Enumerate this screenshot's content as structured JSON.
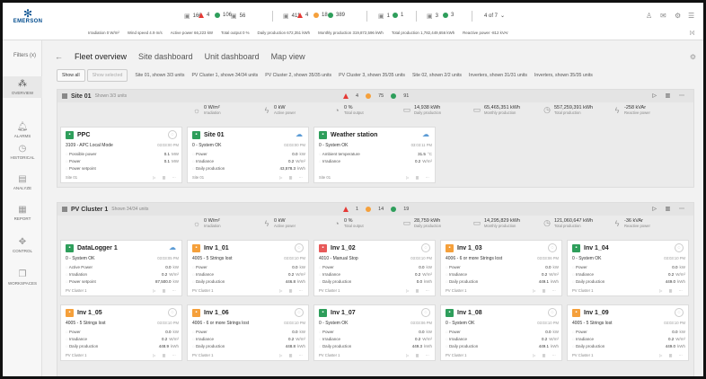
{
  "brand": {
    "logo_text": "EMERSON"
  },
  "topbar": {
    "counts": [
      {
        "icon": "inverter-icon",
        "value": "166",
        "color": "#888888"
      },
      {
        "icon": "alarm-triangle-icon",
        "value": "4",
        "color": "#e53935"
      },
      {
        "icon": "dot-green-icon",
        "value": "106",
        "color": "#2e9e5b"
      },
      {
        "icon": "link-icon",
        "value": "56",
        "color": "#888888"
      },
      {
        "icon": "meter-icon",
        "value": "411",
        "color": "#888888"
      },
      {
        "icon": "alarm-triangle-icon",
        "value": "4",
        "color": "#e53935"
      },
      {
        "icon": "dot-orange-icon",
        "value": "18",
        "color": "#f5a03b"
      },
      {
        "icon": "dot-green-icon",
        "value": "389",
        "color": "#2e9e5b"
      },
      {
        "icon": "device-icon",
        "value": "1",
        "color": "#888888"
      },
      {
        "icon": "dot-green-icon",
        "value": "1",
        "color": "#2e9e5b"
      },
      {
        "icon": "grid-icon",
        "value": "3",
        "color": "#888888"
      },
      {
        "icon": "dot-green-icon",
        "value": "3",
        "color": "#2e9e5b"
      }
    ],
    "pager": "4 of 7",
    "stats": [
      "Irradiation 0 W/m²",
      "Wind speed 4.9 m/s",
      "Active power 66,223 kW",
      "Total output 0 %",
      "Daily production 672,351 kWh",
      "Monthly production 319,872,596 kWh",
      "Total production 1,782,449,656 kWh",
      "Reactive power -812 kVAr"
    ],
    "right_icon": "[x]"
  },
  "sidebar": {
    "filters_label": "Filters",
    "filters_count": "(x)",
    "items": [
      {
        "label": "OVERVIEW",
        "icon": "overview-icon",
        "glyph": "⁂",
        "active": true
      },
      {
        "label": "ALARMS",
        "icon": "alarm-bell-icon",
        "glyph": "🔔︎",
        "active": false
      },
      {
        "label": "HISTORICAL",
        "icon": "history-icon",
        "glyph": "◷",
        "active": false
      },
      {
        "label": "ANALYZE",
        "icon": "analyze-icon",
        "glyph": "▤",
        "active": false
      },
      {
        "label": "REPORT",
        "icon": "report-icon",
        "glyph": "▦",
        "active": false
      },
      {
        "label": "CONTROL",
        "icon": "control-icon",
        "glyph": "✥",
        "active": false
      },
      {
        "label": "WORKSPACES",
        "icon": "workspaces-icon",
        "glyph": "❐",
        "active": false
      }
    ]
  },
  "nav": {
    "back": "←",
    "tabs": [
      "Fleet overview",
      "Site dashboard",
      "Unit dashboard",
      "Map view"
    ]
  },
  "chips": {
    "show_all": "Show all",
    "show_selected": "Show selected",
    "items": [
      "Site 01, shown 3/3 units",
      "PV Cluster 1, shown 34/34 units",
      "PV Cluster 2, shown 35/35 units",
      "PV Cluster 3, shown 35/35 units",
      "Site 02, shown 2/2 units",
      "Inverters, shown 31/31 units",
      "Inverters, shown 35/35 units"
    ]
  },
  "sections": [
    {
      "title": "Site 01",
      "subtitle": "Shown 3/3 units",
      "counts": {
        "alarm": "4",
        "orange": "75",
        "green": "91"
      },
      "kpis": [
        {
          "icon": "irradiation-icon",
          "value": "0 W/m²",
          "label": "Irradiation"
        },
        {
          "icon": "bolt-icon",
          "value": "0 kW",
          "label": "Active power"
        },
        {
          "icon": "gauge-icon",
          "value": "0 %",
          "label": "Total output"
        },
        {
          "icon": "production-icon",
          "value": "14,938 kWh",
          "label": "Daily production"
        },
        {
          "icon": "production-icon",
          "value": "65,465,351 kWh",
          "label": "Monthly production"
        },
        {
          "icon": "clock-icon",
          "value": "557,259,391 kWh",
          "label": "Total production"
        },
        {
          "icon": "bolt-icon",
          "value": "-258 kVAr",
          "label": "Reactive power"
        }
      ],
      "cards": [
        {
          "title": "PPC",
          "color": "green",
          "corner": "circle",
          "status": "3109 - APC Local Mode",
          "time": "03:03:00 PM",
          "rows": [
            {
              "label": "Possible power",
              "value": "0.1",
              "unit": "MW"
            },
            {
              "label": "Power",
              "value": "0.1",
              "unit": "MW"
            },
            {
              "label": "Power setpoint",
              "value": "",
              "unit": ""
            }
          ],
          "footer": "Site 01"
        },
        {
          "title": "Site 01",
          "color": "green",
          "corner": "cloud",
          "status": "0 - System OK",
          "time": "03:03:00 PM",
          "rows": [
            {
              "label": "Power",
              "value": "0.0",
              "unit": "kW"
            },
            {
              "label": "Irradiance",
              "value": "0.2",
              "unit": "W/m²"
            },
            {
              "label": "Daily production",
              "value": "43,578.3",
              "unit": "kWh"
            }
          ],
          "footer": "Site 01"
        },
        {
          "title": "Weather station",
          "color": "green",
          "corner": "cloud",
          "status": "0 - System OK",
          "time": "03:03:11 PM",
          "rows": [
            {
              "label": "Ambient temperature",
              "value": "31.5",
              "unit": "°C"
            },
            {
              "label": "Irradiance",
              "value": "0.2",
              "unit": "W/m²"
            }
          ],
          "footer": "Site 01"
        }
      ]
    },
    {
      "title": "PV Cluster 1",
      "subtitle": "Shown 34/34 units",
      "counts": {
        "alarm": "1",
        "orange": "14",
        "green": "19"
      },
      "kpis": [
        {
          "icon": "irradiation-icon",
          "value": "0 W/m²",
          "label": "Irradiation"
        },
        {
          "icon": "bolt-icon",
          "value": "0 kW",
          "label": "Active power"
        },
        {
          "icon": "gauge-icon",
          "value": "0 %",
          "label": "Total output"
        },
        {
          "icon": "production-icon",
          "value": "28,759 kWh",
          "label": "Daily production"
        },
        {
          "icon": "production-icon",
          "value": "14,295,829 kWh",
          "label": "Monthly production"
        },
        {
          "icon": "clock-icon",
          "value": "121,060,647 kWh",
          "label": "Total production"
        },
        {
          "icon": "bolt-icon",
          "value": "-36 kVAr",
          "label": "Reactive power"
        }
      ],
      "cards": [
        {
          "title": "DataLogger 1",
          "color": "green",
          "corner": "cloud",
          "status": "0 - System OK",
          "time": "03:03:05 PM",
          "rows": [
            {
              "label": "Active Power",
              "value": "0.0",
              "unit": "kW"
            },
            {
              "label": "Irradiation",
              "value": "0.2",
              "unit": "W/m²"
            },
            {
              "label": "Power setpoint",
              "value": "87,500.0",
              "unit": "kW"
            }
          ],
          "footer": "PV Cluster 1"
        },
        {
          "title": "Inv 1_01",
          "color": "orange",
          "corner": "circle",
          "status": "4005 - 5 Strings lost",
          "time": "03:03:10 PM",
          "rows": [
            {
              "label": "Power",
              "value": "0.0",
              "unit": "kW"
            },
            {
              "label": "Irradiance",
              "value": "0.2",
              "unit": "W/m²"
            },
            {
              "label": "Daily production",
              "value": "446.8",
              "unit": "kWh"
            }
          ],
          "footer": "PV Cluster 1"
        },
        {
          "title": "Inv 1_02",
          "color": "red",
          "corner": "circle",
          "status": "4010 - Manual Stop",
          "time": "03:03:10 PM",
          "rows": [
            {
              "label": "Power",
              "value": "0.0",
              "unit": "kW"
            },
            {
              "label": "Irradiance",
              "value": "0.2",
              "unit": "W/m²"
            },
            {
              "label": "Daily production",
              "value": "0.0",
              "unit": "kWh"
            }
          ],
          "footer": "PV Cluster 1"
        },
        {
          "title": "Inv 1_03",
          "color": "orange",
          "corner": "circle",
          "status": "4006 - 6 or more Strings lost",
          "time": "03:03:06 PM",
          "rows": [
            {
              "label": "Power",
              "value": "0.0",
              "unit": "kW"
            },
            {
              "label": "Irradiance",
              "value": "0.2",
              "unit": "W/m²"
            },
            {
              "label": "Daily production",
              "value": "449.1",
              "unit": "kWh"
            }
          ],
          "footer": "PV Cluster 1"
        },
        {
          "title": "Inv 1_04",
          "color": "green",
          "corner": "circle",
          "status": "0 - System OK",
          "time": "03:03:10 PM",
          "rows": [
            {
              "label": "Power",
              "value": "0.0",
              "unit": "kW"
            },
            {
              "label": "Irradiance",
              "value": "0.2",
              "unit": "W/m²"
            },
            {
              "label": "Daily production",
              "value": "449.0",
              "unit": "kWh"
            }
          ],
          "footer": "PV Cluster 1"
        },
        {
          "title": "Inv 1_05",
          "color": "orange",
          "corner": "circle",
          "status": "4005 - 5 Strings lost",
          "time": "03:03:10 PM",
          "rows": [
            {
              "label": "Power",
              "value": "0.0",
              "unit": "kW"
            },
            {
              "label": "Irradiance",
              "value": "0.2",
              "unit": "W/m²"
            },
            {
              "label": "Daily production",
              "value": "448.9",
              "unit": "kWh"
            }
          ],
          "footer": "PV Cluster 1"
        },
        {
          "title": "Inv 1_06",
          "color": "orange",
          "corner": "circle",
          "status": "4006 - 6 or more Strings lost",
          "time": "03:03:10 PM",
          "rows": [
            {
              "label": "Power",
              "value": "0.0",
              "unit": "kW"
            },
            {
              "label": "Irradiance",
              "value": "0.2",
              "unit": "W/m²"
            },
            {
              "label": "Daily production",
              "value": "448.8",
              "unit": "kWh"
            }
          ],
          "footer": "PV Cluster 1"
        },
        {
          "title": "Inv 1_07",
          "color": "green",
          "corner": "circle",
          "status": "0 - System OK",
          "time": "03:03:06 PM",
          "rows": [
            {
              "label": "Power",
              "value": "0.0",
              "unit": "kW"
            },
            {
              "label": "Irradiance",
              "value": "0.2",
              "unit": "W/m²"
            },
            {
              "label": "Daily production",
              "value": "449.3",
              "unit": "kWh"
            }
          ],
          "footer": "PV Cluster 1"
        },
        {
          "title": "Inv 1_08",
          "color": "green",
          "corner": "circle",
          "status": "0 - System OK",
          "time": "03:03:10 PM",
          "rows": [
            {
              "label": "Power",
              "value": "0.0",
              "unit": "kW"
            },
            {
              "label": "Irradiance",
              "value": "0.2",
              "unit": "W/m²"
            },
            {
              "label": "Daily production",
              "value": "449.1",
              "unit": "kWh"
            }
          ],
          "footer": "PV Cluster 1"
        },
        {
          "title": "Inv 1_09",
          "color": "orange",
          "corner": "circle",
          "status": "4005 - 5 Strings lost",
          "time": "03:03:10 PM",
          "rows": [
            {
              "label": "Power",
              "value": "0.0",
              "unit": "kW"
            },
            {
              "label": "Irradiance",
              "value": "0.2",
              "unit": "W/m²"
            },
            {
              "label": "Daily production",
              "value": "449.0",
              "unit": "kWh"
            }
          ],
          "footer": "PV Cluster 1"
        }
      ]
    }
  ]
}
